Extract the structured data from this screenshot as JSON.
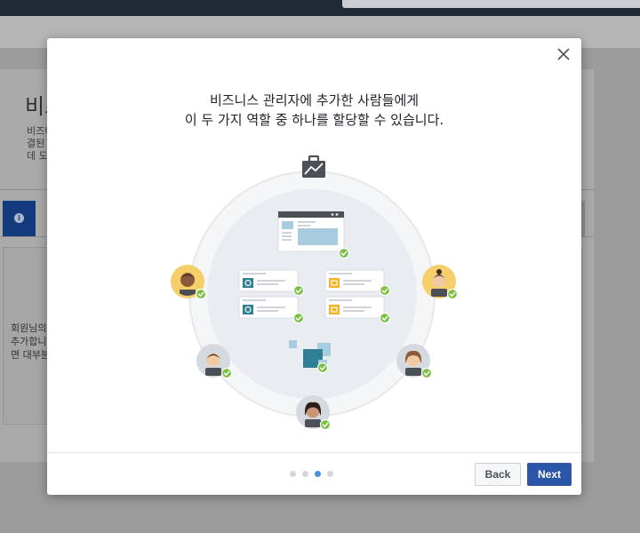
{
  "background": {
    "title": "비즈",
    "description_lines": [
      "비즈니",
      "결된",
      "데 도"
    ],
    "card_text_lines": [
      "회원님의",
      "추가합니",
      "면 대부분"
    ]
  },
  "modal": {
    "headline": {
      "line1": "비즈니스 관리자에 추가한 사람들에게",
      "line2": "이 두 가지 역할 중 하나를 할당할 수 있습니다."
    },
    "pagination": {
      "total": 4,
      "current_index": 2
    },
    "buttons": {
      "back_label": "Back",
      "next_label": "Next"
    }
  },
  "colors": {
    "accent_blue": "#2a55a8",
    "check_green": "#7bc043",
    "active_dot": "#4a90e2",
    "teal_icon": "#2f7f95",
    "yellow_icon": "#f0b429"
  },
  "icons": [
    "close-icon",
    "briefcase-icon",
    "check-icon",
    "person-icon"
  ]
}
